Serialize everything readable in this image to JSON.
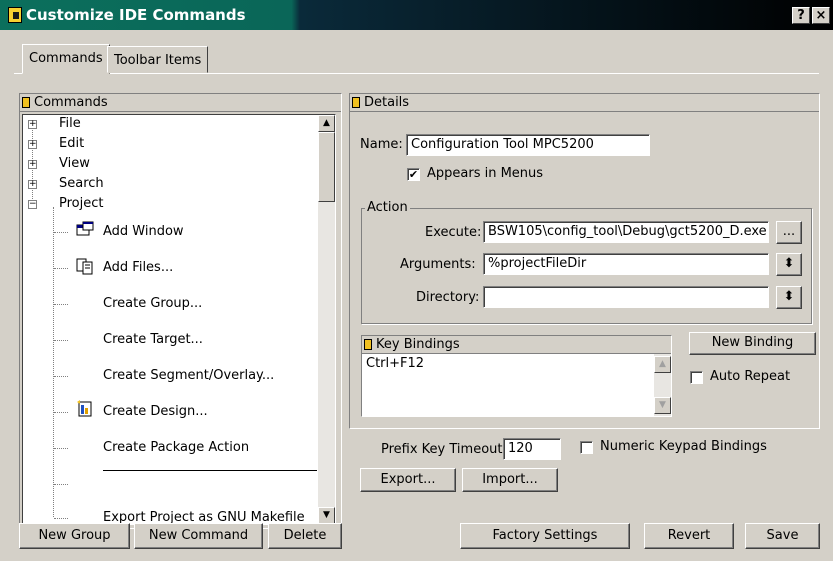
{
  "window": {
    "title": "Customize IDE Commands",
    "help_btn": "?",
    "close_btn": "×"
  },
  "tabs": [
    {
      "label": "Commands"
    },
    {
      "label": "Toolbar Items"
    }
  ],
  "commands_panel": {
    "header": "Commands",
    "tree": {
      "top": [
        {
          "label": "File",
          "expander": "+"
        },
        {
          "label": "Edit",
          "expander": "+"
        },
        {
          "label": "View",
          "expander": "+"
        },
        {
          "label": "Search",
          "expander": "+"
        },
        {
          "label": "Project",
          "expander": "−"
        }
      ],
      "children": [
        "Add Window",
        "Add Files...",
        "Create Group...",
        "Create Target...",
        "Create Segment/Overlay...",
        "Create Design...",
        "Create Package Action",
        "Export Project as GNU Makefile"
      ]
    },
    "scroll_up": "▲",
    "scroll_down": "▼"
  },
  "details_panel": {
    "header": "Details",
    "name_label": "Name:",
    "name_value": "Configuration Tool MPC5200",
    "appears_label": "Appears in Menus",
    "appears_checked": "✔",
    "action_label": "Action",
    "execute_label": "Execute:",
    "execute_value": "BSW105\\config_tool\\Debug\\gct5200_D.exe",
    "browse_btn": "...",
    "arguments_label": "Arguments:",
    "arguments_value": "%projectFileDir",
    "directory_label": "Directory:",
    "directory_value": "",
    "spin_glyph": "⬍"
  },
  "key_bindings": {
    "header": "Key Bindings",
    "items": [
      "Ctrl+F12"
    ],
    "new_binding": "New Binding",
    "auto_repeat": "Auto Repeat"
  },
  "prefix": {
    "label": "Prefix Key Timeout:",
    "value": "120",
    "numeric_label": "Numeric Keypad Bindings"
  },
  "export_btn": "Export...",
  "import_btn": "Import...",
  "bottom": {
    "new_group": "New Group",
    "new_command": "New Command",
    "delete": "Delete",
    "factory": "Factory Settings",
    "revert": "Revert",
    "save": "Save"
  }
}
